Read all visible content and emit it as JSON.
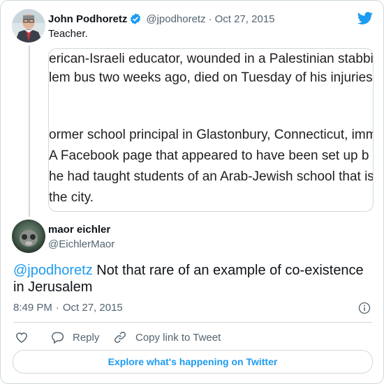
{
  "quoted": {
    "display_name": "John Podhoretz",
    "handle": "@jpodhoretz",
    "separator": "·",
    "date": "Oct 27, 2015",
    "text": "Teacher.",
    "embedded_article_lines": [
      "erican-Israeli educator, wounded in a Palestinian stabbin",
      "lem bus two weeks ago, died on Tuesday of his injuries",
      "ormer school principal in Glastonbury, Connecticut, immi",
      " A Facebook page that appeared to have been set up b",
      "he had taught students of an Arab-Jewish school that is",
      "the city."
    ]
  },
  "reply": {
    "display_name": "maor eichler",
    "handle": "@EichlerMaor",
    "mention": "@jpodhoretz",
    "text": " Not that rare of an example of co-existence in Jerusalem",
    "time": "8:49 PM",
    "separator": "·",
    "date": "Oct 27, 2015"
  },
  "actions": {
    "reply_label": "Reply",
    "copy_link_label": "Copy link to Tweet"
  },
  "explore_label": "Explore what's happening on Twitter",
  "icons": {
    "brand": "twitter-bird-icon",
    "verified": "verified-badge-icon",
    "info": "info-icon",
    "like": "heart-icon",
    "reply": "reply-bubble-icon",
    "copy_link": "link-icon"
  },
  "colors": {
    "accent": "#1d9bf0",
    "text": "#0f1419",
    "muted": "#536471",
    "border": "#cfd9de"
  }
}
